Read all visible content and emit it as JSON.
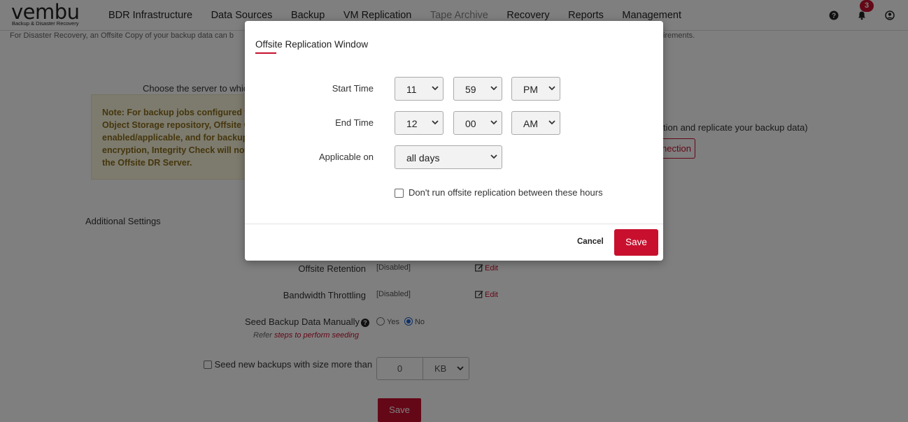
{
  "app": {
    "logo_word": "vembu",
    "logo_tagline": "Backup & Disaster Recovery",
    "accent_color": "#c8102e"
  },
  "nav": {
    "items": [
      {
        "label": "BDR Infrastructure"
      },
      {
        "label": "Data Sources"
      },
      {
        "label": "Backup"
      },
      {
        "label": "VM Replication"
      },
      {
        "label": "Tape Archive"
      },
      {
        "label": "Recovery"
      },
      {
        "label": "Reports"
      },
      {
        "label": "Management"
      }
    ],
    "icons": [
      "help-icon",
      "bell-icon",
      "user-icon"
    ],
    "notification_count": "3"
  },
  "page": {
    "intro_text": "For Disaster Recovery, an Offsite Copy of your backup data can b",
    "intro_tail": "irements.",
    "choose_text": "Choose the server to whic",
    "note_text": "Note: For backup jobs configured wi\nObject Storage repository, Offsite C\nenabled/applicable, and for backup j\nencryption, Integrity Check will not\nthe Offsite DR Server.",
    "right_note": "tion and replicate your backup data)",
    "connection_button_fragment": "nection",
    "additional_settings_title": "Additional Settings",
    "offsite_retention": {
      "label": "Offsite Retention",
      "value": "[Disabled]",
      "edit": "Edit"
    },
    "bandwidth_throttling": {
      "label": "Bandwidth Throttling",
      "value": "[Disabled]",
      "edit": "Edit"
    },
    "seed_backup": {
      "label": "Seed Backup Data Manually",
      "option_yes": "Yes",
      "option_no": "No",
      "selected": "No",
      "refer_prefix": "Refer",
      "refer_link": "steps to perform seeding"
    },
    "seed_size": {
      "label": "Seed new backups with size more than",
      "value": "0",
      "unit": "KB"
    },
    "save_label": "Save"
  },
  "modal": {
    "title": "Offsite Replication Window",
    "start_time": {
      "label": "Start Time",
      "hour": "11",
      "minute": "59",
      "period": "PM"
    },
    "end_time": {
      "label": "End Time",
      "hour": "12",
      "minute": "00",
      "period": "AM"
    },
    "applicable_on": {
      "label": "Applicable on",
      "value": "all days"
    },
    "dont_run_label": "Don't run offsite replication between these hours",
    "dont_run_checked": false,
    "cancel_label": "Cancel",
    "save_label": "Save"
  }
}
